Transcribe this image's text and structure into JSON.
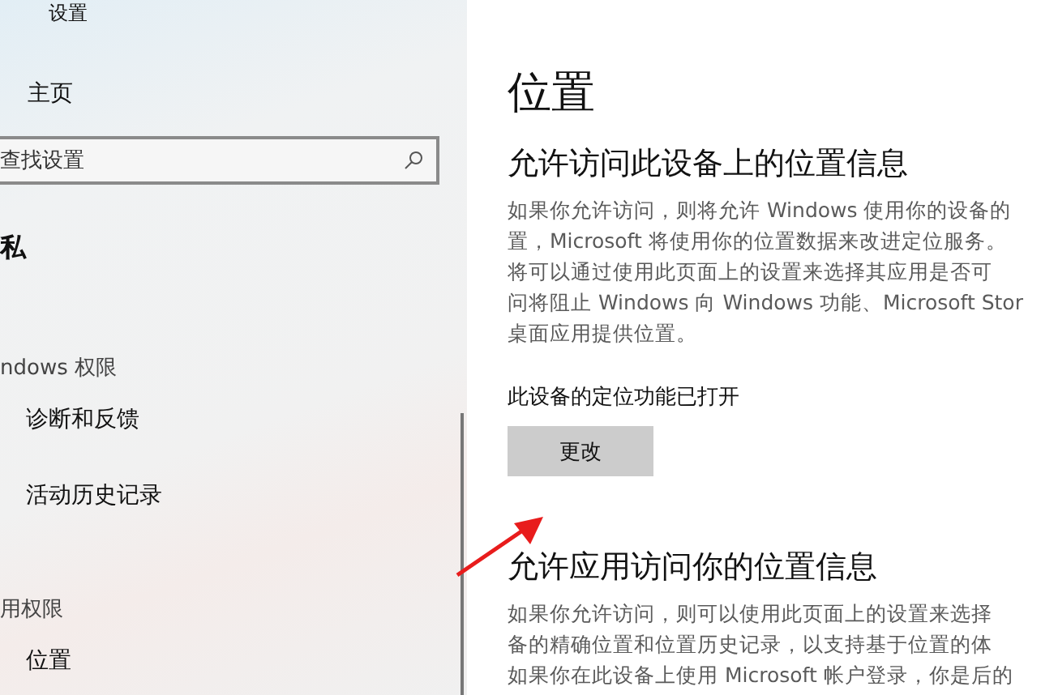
{
  "sidebar": {
    "app_title": "设置",
    "home": "主页",
    "search": {
      "placeholder": "查找设置"
    },
    "items": [
      {
        "kind": "heading",
        "label": "私"
      },
      {
        "kind": "section",
        "label": "ndows 权限"
      },
      {
        "kind": "item",
        "label": "诊断和反馈"
      },
      {
        "kind": "item",
        "label": "活动历史记录"
      },
      {
        "kind": "section",
        "label": "用权限"
      },
      {
        "kind": "item",
        "label": "位置"
      }
    ]
  },
  "main": {
    "title": "位置",
    "sections": [
      {
        "heading": "允许访问此设备上的位置信息",
        "lines": [
          "如果你允许访问，则将允许 Windows 使用你的设备的",
          "置，Microsoft 将使用你的位置数据来改进定位服务。",
          "将可以通过使用此页面上的设置来选择其应用是否可",
          "问将阻止 Windows 向 Windows 功能、Microsoft Stor",
          "桌面应用提供位置。"
        ],
        "status": "此设备的定位功能已打开",
        "button": "更改"
      },
      {
        "heading": "允许应用访问你的位置信息",
        "lines": [
          "如果你允许访问，则可以使用此页面上的设置来选择",
          "备的精确位置和位置历史记录，以支持基于位置的体",
          "如果你在此设备上使用 Microsoft 帐户登录，你是后的"
        ]
      }
    ]
  }
}
